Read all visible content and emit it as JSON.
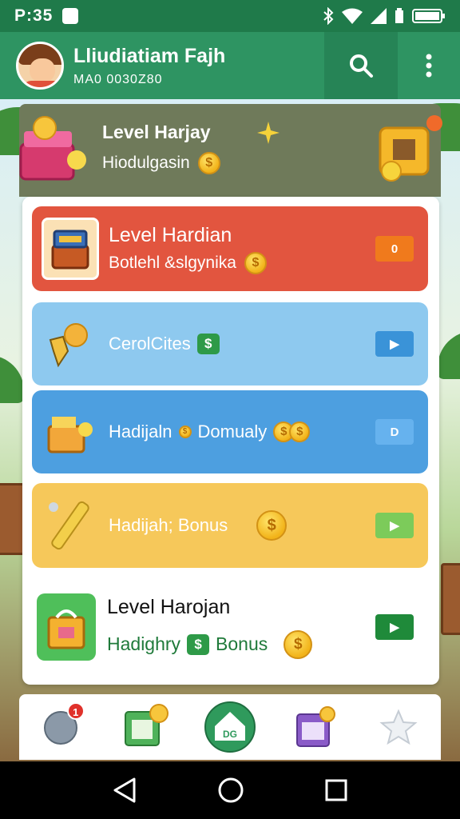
{
  "status_bar": {
    "time": "P:35"
  },
  "app_bar": {
    "title": "Lliudiatiam Fajh",
    "subtitle": "MA0 0030Z80"
  },
  "banner": {
    "title": "Level Harjay",
    "subtitle": "Hiodulgasin"
  },
  "cards": [
    {
      "title": "Level Hardian",
      "subtitle": "Botlehl &slgynika",
      "color": "#e2553f",
      "action_color": "#f07a1c",
      "action_glyph": "0"
    },
    {
      "text": "CerolCites",
      "color": "#8ec9ef",
      "action_color": "#3a93d8",
      "action_glyph": "▶"
    },
    {
      "text": "Hadijaln",
      "text2": "Domualy",
      "color": "#4d9fe0",
      "action_color": "#66b2ee",
      "action_glyph": "D"
    },
    {
      "text": "Hadijah; Bonus",
      "color": "#f6c85a",
      "action_color": "#7ccb5a",
      "action_glyph": "▶"
    }
  ],
  "plain_card": {
    "title": "Level Harojan",
    "subtitle_start": "Hadighry",
    "subtitle_end": "Bonus",
    "action_color": "#1f8a3a"
  },
  "bottom_nav": {
    "notification_count": "1",
    "home_label": "DG"
  },
  "colors": {
    "primary": "#2e9462",
    "status_bar": "#1f7a4a"
  }
}
